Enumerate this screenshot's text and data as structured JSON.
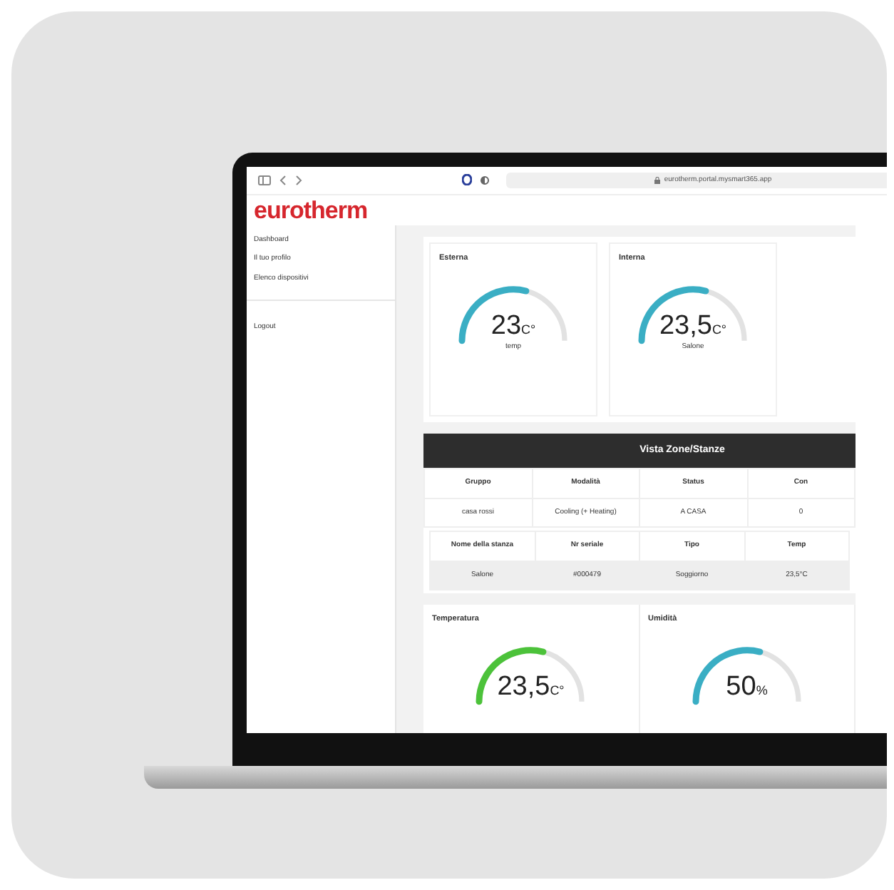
{
  "browser": {
    "url": "eurotherm.portal.mysmart365.app"
  },
  "logo": "eurotherm",
  "sidebar": {
    "items": [
      "Dashboard",
      "Il tuo profilo",
      "Elenco dispositivi"
    ],
    "logout": "Logout"
  },
  "top_gauges": [
    {
      "title": "Esterna",
      "value": "23",
      "unit": "C°",
      "caption": "temp",
      "level": 0.58,
      "color": "#3aaec4"
    },
    {
      "title": "Interna",
      "value": "23,5",
      "unit": "C°",
      "caption": "Salone",
      "level": 0.58,
      "color": "#3aaec4"
    }
  ],
  "zones": {
    "title": "Vista Zone/Stanze",
    "columns": [
      "Gruppo",
      "Modalità",
      "Status",
      "Con"
    ],
    "rows": [
      [
        "casa rossi",
        "Cooling (+ Heating)",
        "A CASA",
        "0"
      ]
    ]
  },
  "rooms": {
    "columns": [
      "Nome della stanza",
      "Nr seriale",
      "Tipo",
      "Temp"
    ],
    "rows": [
      [
        "Salone",
        "#000479",
        "Soggiorno",
        "23,5°C"
      ]
    ]
  },
  "bottom_gauges": [
    {
      "title": "Temperatura",
      "value": "23,5",
      "unit": "C°",
      "level": 0.58,
      "color": "#4cc23a"
    },
    {
      "title": "Umidità",
      "value": "50",
      "unit": "%",
      "level": 0.58,
      "color": "#3aaec4"
    }
  ]
}
